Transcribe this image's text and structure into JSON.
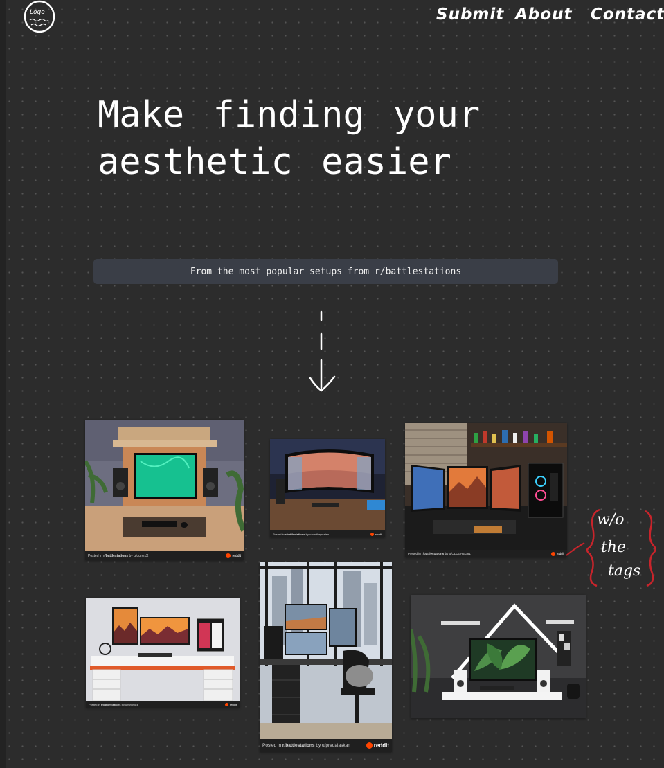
{
  "header": {
    "logo_text": "Logo",
    "nav": [
      {
        "label": "Submit"
      },
      {
        "label": "About"
      },
      {
        "label": "Contact"
      }
    ]
  },
  "hero": {
    "headline": "Make finding your aesthetic easier",
    "subtitle": "From the most popular setups from r/battlestations"
  },
  "gallery": {
    "cards": [
      {
        "subreddit": "r/battlestations",
        "caption_prefix": "Posted in",
        "by": "by",
        "user": "u/gunexX",
        "source": "reddit"
      },
      {
        "subreddit": "r/battlestations",
        "caption_prefix": "Posted in",
        "by": "by",
        "user": "u/mattkeystaten",
        "source": "reddit"
      },
      {
        "subreddit": "r/battlestations",
        "caption_prefix": "Posted in",
        "by": "by",
        "user": "u/OLDGREG81",
        "source": "reddit"
      },
      {
        "subreddit": "r/battlestations",
        "caption_prefix": "Posted in",
        "by": "by",
        "user": "u/mrjosl84",
        "source": "reddit"
      },
      {
        "subreddit": "r/battlestations",
        "caption_prefix": "Posted in",
        "by": "by",
        "user": "u/pradalaskan",
        "source": "reddit"
      },
      {
        "subreddit": "",
        "caption_prefix": "",
        "by": "",
        "user": "",
        "source": ""
      }
    ]
  },
  "annotation": {
    "lines": [
      "w/o",
      "the",
      "tags"
    ],
    "color": "#c8242b"
  },
  "colors": {
    "background": "#2c2c2c",
    "dot": "#555555",
    "subtitle_bar": "#3a3e47",
    "reddit": "#ff4500"
  }
}
